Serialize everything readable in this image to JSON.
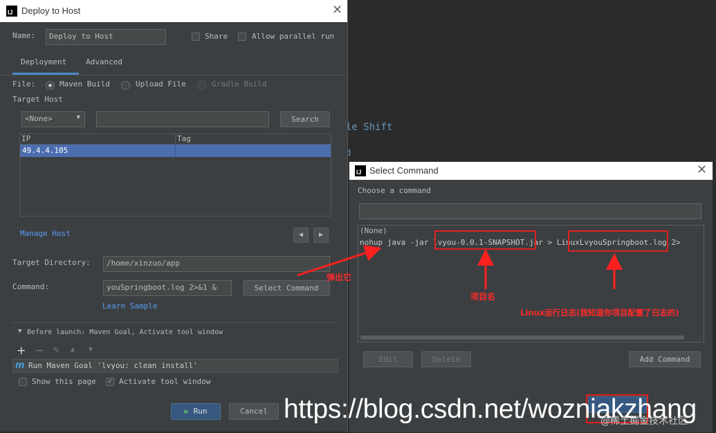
{
  "background": {
    "shortcut_text": "le Shift"
  },
  "deploy": {
    "title": "Deploy to Host",
    "name_label": "Name:",
    "name_value": "Deploy to Host",
    "share_label": "Share",
    "parallel_label": "Allow parallel run",
    "tabs": [
      "Deployment",
      "Advanced"
    ],
    "file_label": "File:",
    "file_options": [
      "Maven Build",
      "Upload File",
      "Gradle Build"
    ],
    "target_host_label": "Target Host",
    "host_select": "<None>",
    "search_button": "Search",
    "table_headers": [
      "IP",
      "Tag"
    ],
    "table_row": {
      "ip": "49.4.4.105",
      "tag": ""
    },
    "manage_host": "Manage Host",
    "target_dir_label": "Target Directory:",
    "target_dir_value": "/home/xinzuo/app",
    "command_label": "Command:",
    "command_value": "youSpringboot.log 2>&1 &",
    "select_command_button": "Select Command",
    "learn_sample": "Learn Sample",
    "before_launch": "Before launch: Maven Goal, Activate tool window",
    "maven_task": "Run Maven Goal 'lvyou: clean install'",
    "show_page_label": "Show this page",
    "activate_window_label": "Activate tool window",
    "run_button": "Run",
    "cancel_button": "Cancel"
  },
  "select_command": {
    "title": "Select Command",
    "prompt": "Choose a command",
    "search_value": "",
    "list_items": [
      "(None)",
      "nohup java -jar lvyou-0.0.1-SNAPSHOT.jar  > LinuxLvyouSpringboot.log 2>"
    ],
    "edit_button": "Edit",
    "delete_button": "Delete",
    "add_button": "Add Command"
  },
  "annotations": {
    "popup": "弹出它",
    "project_name": "项目名",
    "linux_log": "Linux运行日志(我知道你项目配置了日志的)"
  },
  "watermark": "https://blog.csdn.net/wozniakzhang",
  "watermark_small": "@稀土掘金技术社区",
  "colors": {
    "accent": "#4b6eaf",
    "link": "#589df6",
    "annotation": "#ff2020"
  }
}
